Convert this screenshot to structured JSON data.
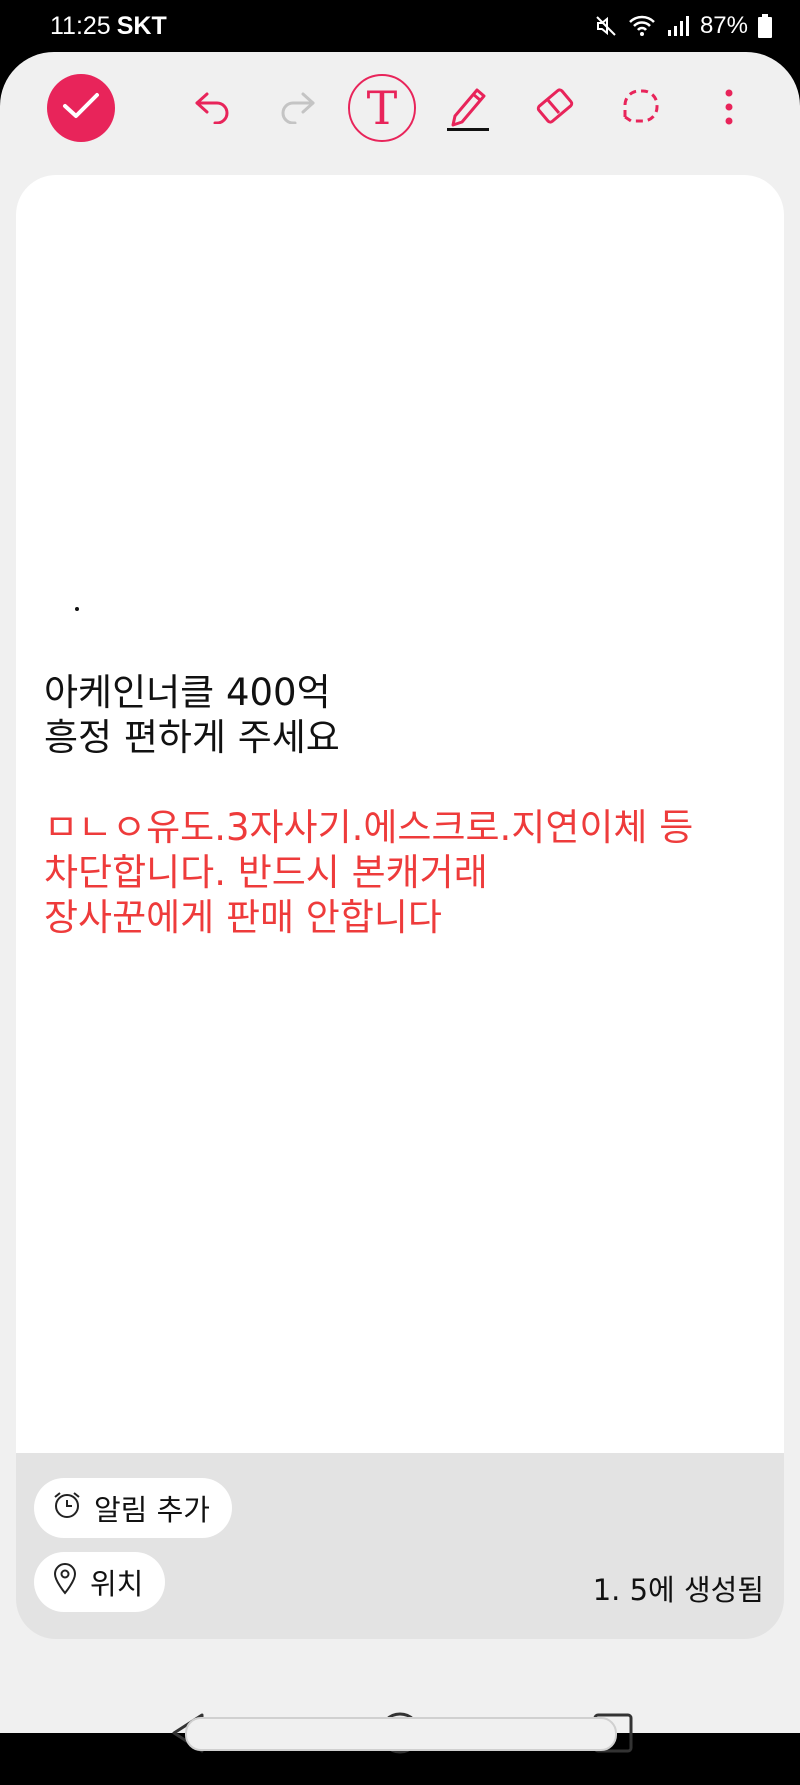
{
  "status": {
    "time": "11:25",
    "carrier": "SKT",
    "battery": "87%",
    "icons": [
      "mute-icon",
      "wifi-icon",
      "signal-icon",
      "battery-icon"
    ]
  },
  "toolbar": {
    "accent": "#e8245a",
    "text_tool_glyph": "T",
    "icons": [
      "check-icon",
      "undo-icon",
      "redo-icon",
      "text-tool-icon",
      "pen-icon",
      "eraser-icon",
      "lasso-icon",
      "more-icon"
    ]
  },
  "note": {
    "dot": ".",
    "lines_black": [
      "아케인너클 400억",
      "흥정 편하게 주세요"
    ],
    "lines_red": [
      "ㅁㄴㅇ유도.3자사기.에스크로.지연이체 등",
      "차단합니다. 반드시 본캐거래",
      "장사꾼에게 판매 안합니다"
    ],
    "red_color": "#ee3b3b"
  },
  "info": {
    "alarm_label": "알림 추가",
    "location_label": "위치",
    "created_text": "1. 5에 생성됨"
  },
  "nav": {
    "icons": [
      "back-icon",
      "home-icon",
      "recents-icon"
    ]
  }
}
